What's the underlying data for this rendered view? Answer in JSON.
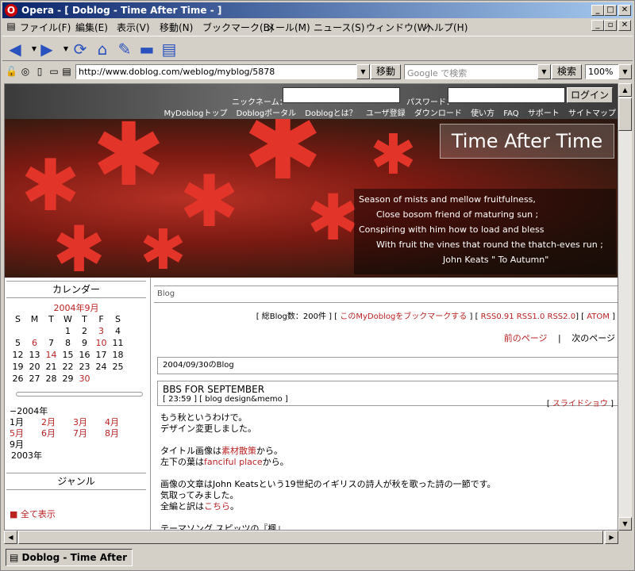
{
  "window": {
    "title": "Opera - [ Doblog - Time After Time - ]",
    "min_glyph": "_",
    "max_glyph": "□",
    "close_glyph": "✕"
  },
  "menu": {
    "items": [
      "ファイル(F)",
      "編集(E)",
      "表示(V)",
      "移動(N)",
      "ブックマーク(B)",
      "メール(M)",
      "ニュース(S)",
      "ウィンドウ(W)",
      "ヘルプ(H)"
    ]
  },
  "toolbar": {
    "back_icon": "◀",
    "forward_icon": "▶",
    "reload_icon": "⟳",
    "home_icon": "⌂",
    "hotlist_icon": "✎",
    "print_icon": "▬",
    "page_icon": "▤"
  },
  "address": {
    "url": "http://www.doblog.com/weblog/myblog/5878",
    "go_label": "移動",
    "search_placeholder": "Google で検索",
    "search_label": "検索",
    "zoom": "100%"
  },
  "site": {
    "nickname_label": "ニックネーム：",
    "password_label": "パスワード：",
    "login_label": "ログイン",
    "nav": [
      "MyDoblogトップ",
      "Doblogポータル",
      "Doblogとは？",
      "ユーザ登録",
      "ダウンロード",
      "使い方",
      "FAQ",
      "サポート",
      "サイトマップ"
    ]
  },
  "banner": {
    "title": "Time After Time",
    "poem": [
      "Season of mists and mellow fruitfulness,",
      "Close bosom friend of maturing sun ;",
      "Conspiring with him how to load and bless",
      "With fruit the vines that round the thatch-eves run ;",
      "John Keats  \" To Autumn\""
    ]
  },
  "sidebar": {
    "calendar_heading": "カレンダー",
    "month": "2004年9月",
    "weekdays": [
      "S",
      "M",
      "T",
      "W",
      "T",
      "F",
      "S"
    ],
    "weeks": [
      [
        "",
        "",
        "",
        "1",
        "2",
        "3",
        "4"
      ],
      [
        "5",
        "6",
        "7",
        "8",
        "9",
        "10",
        "11"
      ],
      [
        "12",
        "13",
        "14",
        "15",
        "16",
        "17",
        "18"
      ],
      [
        "19",
        "20",
        "21",
        "22",
        "23",
        "24",
        "25"
      ],
      [
        "26",
        "27",
        "28",
        "29",
        "30",
        "",
        ""
      ]
    ],
    "archive_year": "−2004年",
    "archive_months": [
      [
        "1月",
        "2月",
        "3月",
        "4月"
      ],
      [
        "5月",
        "6月",
        "7月",
        "8月"
      ]
    ],
    "archive_current": "9月",
    "archive_prev_year": "2003年",
    "genre_heading": "ジャンル",
    "show_all": "■ 全て表示"
  },
  "main": {
    "crumb": "Blog",
    "stats_prefix": "[ 総Blog数：200件 ] [",
    "bookmark_link": "このMyDoblogをブックマークする",
    "stats_mid": "] [",
    "rss": [
      "RSS0.91",
      "RSS1.0",
      "RSS2.0"
    ],
    "stats_mid2": "] [",
    "atom": "ATOM",
    "stats_end": "]",
    "prev_page": "前のページ",
    "page_sep": "|",
    "next_page": "次のページ",
    "date_heading": "2004/09/30のBlog",
    "entry_title": "BBS FOR SEPTEMBER",
    "entry_meta": "[ 23:59 ] [ blog design&memo ]",
    "slideshow_open": "[",
    "slideshow": "スライドショウ",
    "slideshow_close": "]",
    "body": {
      "line1": "もう秋というわけで。",
      "line2": "デザイン変更しました。",
      "line3_pre": "タイトル画像は",
      "line3_link": "素材散策",
      "line3_post": "から。",
      "line4_pre": "左下の葉は",
      "line4_link": "fanciful place",
      "line4_post": "から。",
      "line5": "画像の文章はJohn Keatsという19世紀のイギリスの詩人が秋を歌った詩の一節です。",
      "line6": "気取ってみました。",
      "line7_pre": "全編と訳は",
      "line7_link": "こちら",
      "line7_post": "。",
      "line8": "テーマソング スピッツの『楓』"
    }
  },
  "status": {
    "tab_label": "Doblog - Time After"
  },
  "colors": {
    "titlebar_start": "#0a246a",
    "link": "#b22222",
    "chrome": "#d4d0c8"
  }
}
